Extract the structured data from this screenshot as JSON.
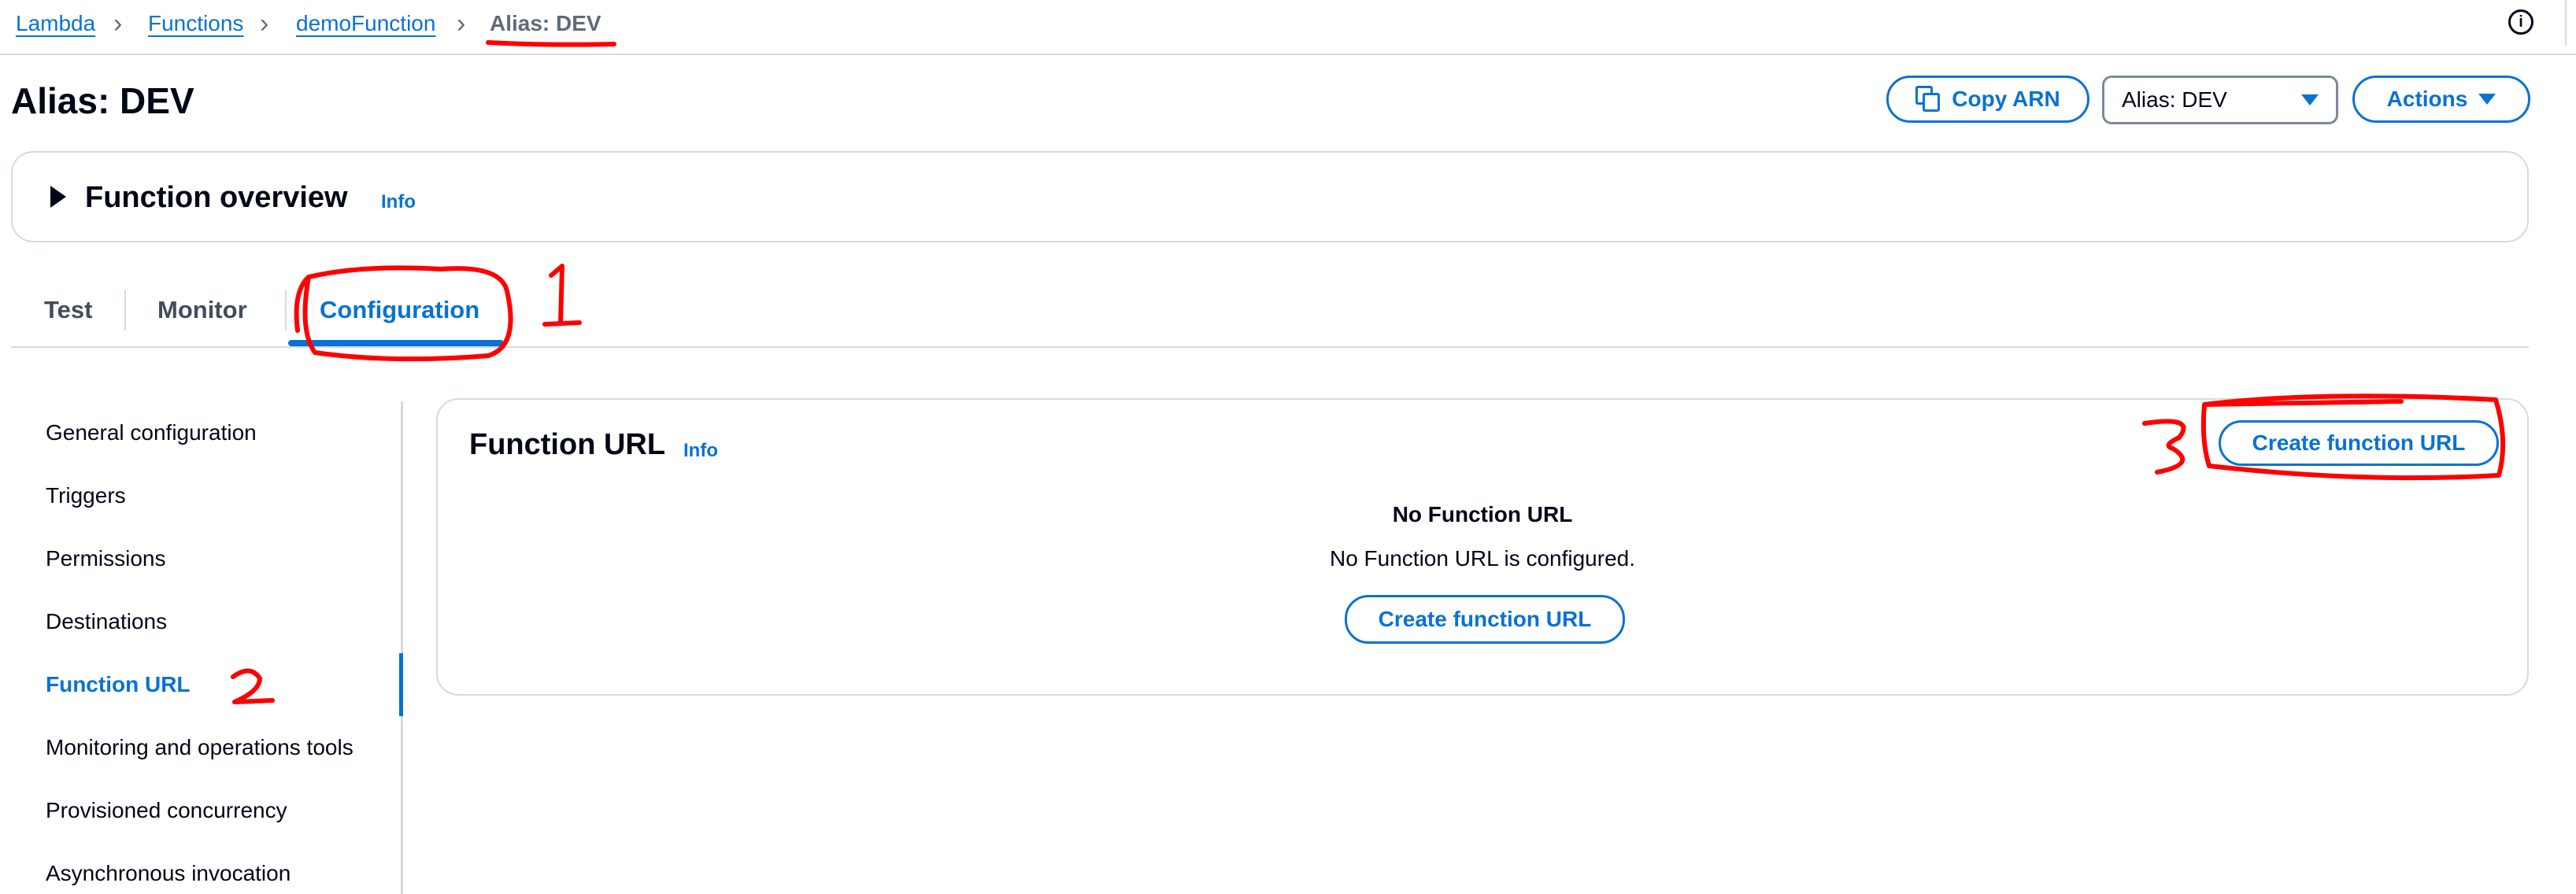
{
  "breadcrumb": {
    "items": [
      "Lambda",
      "Functions",
      "demoFunction"
    ],
    "current": "Alias: DEV",
    "separator": "›"
  },
  "header": {
    "title": "Alias: DEV",
    "copy_arn_label": "Copy ARN",
    "alias_select_value": "Alias: DEV",
    "actions_label": "Actions"
  },
  "overview": {
    "title": "Function overview",
    "info_label": "Info",
    "expanded": false
  },
  "tabs": [
    {
      "label": "Test",
      "active": false
    },
    {
      "label": "Monitor",
      "active": false
    },
    {
      "label": "Configuration",
      "active": true
    }
  ],
  "side_nav": {
    "items": [
      "General configuration",
      "Triggers",
      "Permissions",
      "Destinations",
      "Function URL",
      "Monitoring and operations tools",
      "Provisioned concurrency",
      "Asynchronous invocation"
    ],
    "active": "Function URL"
  },
  "function_url": {
    "title": "Function URL",
    "info_label": "Info",
    "create_label": "Create function URL",
    "empty_heading": "No Function URL",
    "empty_text": "No Function URL is configured."
  },
  "annotations": {
    "labels": [
      "1",
      "2",
      "3"
    ],
    "color": "#ff0000"
  },
  "icons": {
    "info": "info-circle-icon",
    "copy": "copy-icon",
    "caret": "caret-down-icon",
    "expand": "caret-right-icon"
  },
  "colors": {
    "accent": "#0972d3",
    "text": "#000716",
    "muted": "#5f6b7a",
    "border": "#d5dbdb"
  }
}
